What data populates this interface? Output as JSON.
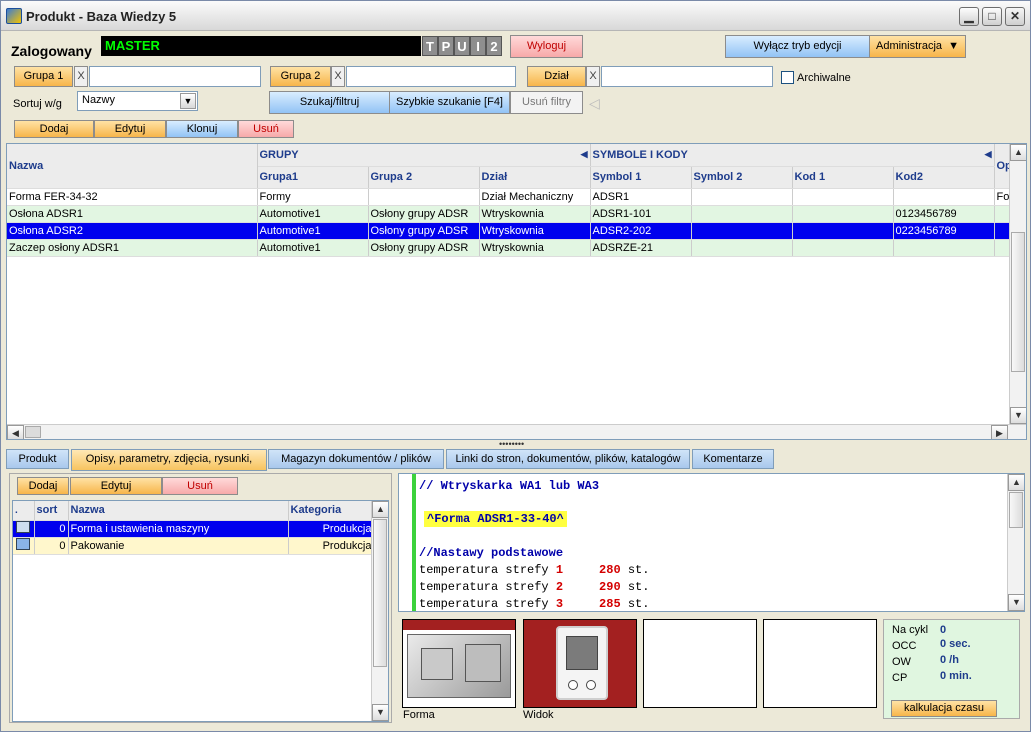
{
  "window": {
    "title": "Produkt - Baza Wiedzy 5"
  },
  "header": {
    "logged_label": "Zalogowany",
    "user": "MASTER",
    "flags": [
      "T",
      "P",
      "U",
      "I",
      "2"
    ],
    "logout": "Wyloguj",
    "edit_mode": "Wyłącz tryb edycji",
    "admin": "Administracja"
  },
  "filters": {
    "group1": "Grupa 1",
    "group2": "Grupa 2",
    "dept": "Dział",
    "x": "X",
    "archived": "Archiwalne",
    "sort_label": "Sortuj w/g",
    "sort_value": "Nazwy",
    "search": "Szukaj/filtruj",
    "quick_search": "Szybkie szukanie [F4]",
    "clear": "Usuń filtry"
  },
  "actions": {
    "add": "Dodaj",
    "edit": "Edytuj",
    "clone": "Klonuj",
    "delete": "Usuń"
  },
  "grid": {
    "name_header": "Nazwa",
    "band_groups": "GRUPY",
    "band_symbols": "SYMBOLE I KODY",
    "band_extra": "Op",
    "columns": [
      "Grupa1",
      "Grupa 2",
      "Dział",
      "Symbol 1",
      "Symbol 2",
      "Kod 1",
      "Kod2"
    ],
    "rows": [
      {
        "name": "Forma FER-34-32",
        "g1": "Formy",
        "g2": "",
        "dept": "Dział Mechaniczny",
        "s1": "ADSR1",
        "s2": "",
        "k1": "",
        "k2": "",
        "extra": "For"
      },
      {
        "name": "Osłona ADSR1",
        "g1": "Automotive1",
        "g2": "Osłony grupy ADSR",
        "dept": "Wtryskownia",
        "s1": "ADSR1-101",
        "s2": "",
        "k1": "",
        "k2": "0123456789",
        "extra": ""
      },
      {
        "name": "Osłona ADSR2",
        "g1": "Automotive1",
        "g2": "Osłony grupy ADSR",
        "dept": "Wtryskownia",
        "s1": "ADSR2-202",
        "s2": "",
        "k1": "",
        "k2": "0223456789",
        "extra": ""
      },
      {
        "name": "Zaczep osłony ADSR1",
        "g1": "Automotive1",
        "g2": "Osłony grupy ADSR",
        "dept": "Wtryskownia",
        "s1": "ADSRZE-21",
        "s2": "",
        "k1": "",
        "k2": "",
        "extra": ""
      }
    ]
  },
  "tabs": [
    "Produkt",
    "Opisy, parametry, zdjęcia, rysunki,",
    "Magazyn dokumentów / plików",
    "Linki do stron, dokumentów, plików, katalogów",
    "Komentarze"
  ],
  "sub": {
    "add": "Dodaj",
    "edit": "Edytuj",
    "delete": "Usuń",
    "columns": [
      ".",
      "sort",
      "Nazwa",
      "Kategoria"
    ],
    "rows": [
      {
        "sort": "0",
        "name": "Forma i ustawienia maszyny",
        "cat": "Produkcja"
      },
      {
        "sort": "0",
        "name": "Pakowanie",
        "cat": "Produkcja"
      }
    ]
  },
  "editor": {
    "line1": "// Wtryskarka WA1 lub WA3",
    "line2": "^Forma ADSR1-33-40^",
    "line3": "//Nastawy podstawowe",
    "temps": [
      {
        "label": "temperatura strefy",
        "n": "1",
        "v": "280",
        "u": "st."
      },
      {
        "label": "temperatura strefy",
        "n": "2",
        "v": "290",
        "u": "st."
      },
      {
        "label": "temperatura strefy",
        "n": "3",
        "v": "285",
        "u": "st."
      }
    ]
  },
  "images": {
    "forma": "Forma",
    "widok": "Widok"
  },
  "calc": {
    "rows": [
      {
        "label": "Na cykl",
        "value": "0"
      },
      {
        "label": "OCC",
        "value": "0 sec."
      },
      {
        "label": "OW",
        "value": "0 /h"
      },
      {
        "label": "CP",
        "value": "0 min."
      }
    ],
    "button": "kalkulacja czasu"
  }
}
